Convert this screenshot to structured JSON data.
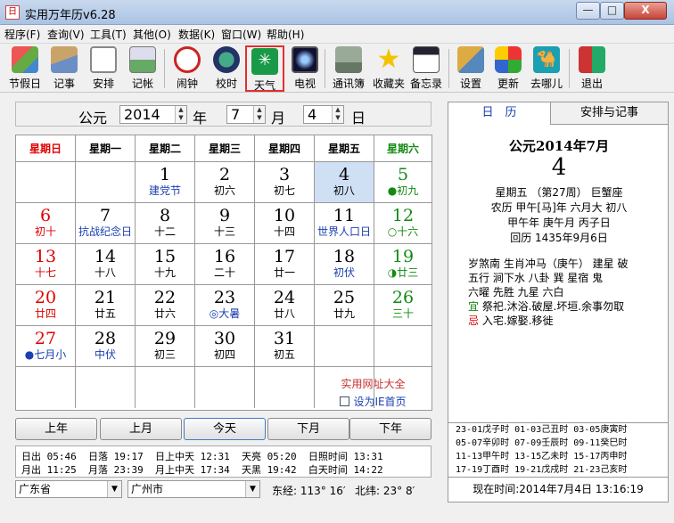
{
  "window": {
    "title": "实用万年历v6.28",
    "min": "—",
    "max": "□",
    "close": "X"
  },
  "menu": [
    "程序(F)",
    "查询(V)",
    "工具(T)",
    "其他(O)",
    "数据(K)",
    "窗口(W)",
    "帮助(H)"
  ],
  "toolbar": [
    {
      "label": "节假日",
      "icon": "holiday-icon"
    },
    {
      "label": "记事",
      "icon": "notes-icon"
    },
    {
      "label": "安排",
      "icon": "schedule-icon"
    },
    {
      "label": "记帐",
      "icon": "ledger-icon"
    },
    {
      "label": "闹钟",
      "icon": "alarm-clock-icon"
    },
    {
      "label": "校时",
      "icon": "time-sync-icon"
    },
    {
      "label": "天气",
      "icon": "weather-icon"
    },
    {
      "label": "电视",
      "icon": "tv-icon"
    },
    {
      "label": "通讯簿",
      "icon": "address-book-icon"
    },
    {
      "label": "收藏夹",
      "icon": "favorites-star-icon"
    },
    {
      "label": "备忘录",
      "icon": "memo-icon"
    },
    {
      "label": "设置",
      "icon": "settings-icon"
    },
    {
      "label": "更新",
      "icon": "update-icon"
    },
    {
      "label": "去哪儿",
      "icon": "camel-icon"
    },
    {
      "label": "退出",
      "icon": "exit-door-icon"
    }
  ],
  "datebar": {
    "era": "公元",
    "year": "2014",
    "year_unit": "年",
    "month": "7",
    "month_unit": "月",
    "day": "4",
    "day_unit": "日"
  },
  "weekdays": [
    "星期日",
    "星期一",
    "星期二",
    "星期三",
    "星期四",
    "星期五",
    "星期六"
  ],
  "weeks": [
    [
      {
        "n": "",
        "s": ""
      },
      {
        "n": "",
        "s": ""
      },
      {
        "n": "1",
        "s": "建党节"
      },
      {
        "n": "2",
        "s": "初六"
      },
      {
        "n": "3",
        "s": "初七"
      },
      {
        "n": "4",
        "s": "初八"
      },
      {
        "n": "5",
        "s": "●初九"
      }
    ],
    [
      {
        "n": "6",
        "s": "初十"
      },
      {
        "n": "7",
        "s": "抗战纪念日"
      },
      {
        "n": "8",
        "s": "十二"
      },
      {
        "n": "9",
        "s": "十三"
      },
      {
        "n": "10",
        "s": "十四"
      },
      {
        "n": "11",
        "s": "世界人口日"
      },
      {
        "n": "12",
        "s": "○十六"
      }
    ],
    [
      {
        "n": "13",
        "s": "十七"
      },
      {
        "n": "14",
        "s": "十八"
      },
      {
        "n": "15",
        "s": "十九"
      },
      {
        "n": "16",
        "s": "二十"
      },
      {
        "n": "17",
        "s": "廿一"
      },
      {
        "n": "18",
        "s": "初伏"
      },
      {
        "n": "19",
        "s": "◑廿三"
      }
    ],
    [
      {
        "n": "20",
        "s": "廿四"
      },
      {
        "n": "21",
        "s": "廿五"
      },
      {
        "n": "22",
        "s": "廿六"
      },
      {
        "n": "23",
        "s": "◎大暑"
      },
      {
        "n": "24",
        "s": "廿八"
      },
      {
        "n": "25",
        "s": "廿九"
      },
      {
        "n": "26",
        "s": "三十"
      }
    ],
    [
      {
        "n": "27",
        "s": "●七月小"
      },
      {
        "n": "28",
        "s": "中伏"
      },
      {
        "n": "29",
        "s": "初三"
      },
      {
        "n": "30",
        "s": "初四"
      },
      {
        "n": "31",
        "s": "初五"
      },
      {
        "n": "",
        "s": ""
      },
      {
        "n": "",
        "s": ""
      }
    ],
    [
      {
        "n": "",
        "s": ""
      },
      {
        "n": "",
        "s": ""
      },
      {
        "n": "",
        "s": ""
      },
      {
        "n": "",
        "s": ""
      },
      {
        "n": "",
        "s": ""
      },
      {
        "n": "",
        "s": ""
      },
      {
        "n": "",
        "s": ""
      }
    ]
  ],
  "cal_links": {
    "sites": "实用网址大全",
    "homepage": "设为IE首页"
  },
  "nav_buttons": [
    "上年",
    "上月",
    "今天",
    "下月",
    "下年"
  ],
  "sun_info": {
    "row1": "日出 05:46  日落 19:17  日上中天 12:31  天亮 05:20  日照时间 13:31",
    "row2": "月出 11:25  月落 23:39  月上中天 17:34  天黑 19:42  白天时间 14:22"
  },
  "location": {
    "province": "广东省",
    "city": "广州市",
    "longitude": "东经: 113° 16′",
    "latitude": "北纬: 23° 8′"
  },
  "right_panel": {
    "tab_calendar": "日　历",
    "tab_schedule": "安排与记事",
    "heading": "公元2014年7月",
    "day": "4",
    "line1": "星期五 （第27周） 巨蟹座",
    "line2": "农历 甲午[马]年 六月大 初八",
    "line3": "甲午年 庚午月 丙子日",
    "line4": "回历 1435年9月6日",
    "almanac": [
      "岁煞南 生肖冲马（庚午） 建星 破",
      "五行 涧下水  八卦 巽  星宿 鬼",
      "六曜 先胜  九星 六白"
    ],
    "yi_label": "宜",
    "yi": "祭祀.沐浴.破屋.坏垣.余事勿取",
    "ji_label": "忌",
    "ji": "入宅.嫁娶.移徙",
    "hours": [
      "23-01戊子时 01-03己丑时 03-05庚寅时",
      "05-07辛卯时 07-09壬辰时 09-11癸巳时",
      "11-13甲午时 13-15乙未时 15-17丙申时",
      "17-19丁酉时 19-21戊戌时 21-23己亥时"
    ],
    "now": "现在时间:2014年7月4日  13:16:19"
  },
  "colors": {
    "sunday": "#e00000",
    "saturday": "#138a13",
    "festival": "#1a3fb0",
    "today_bg": "#cfe0f5",
    "highlight_box": "#e23030"
  }
}
